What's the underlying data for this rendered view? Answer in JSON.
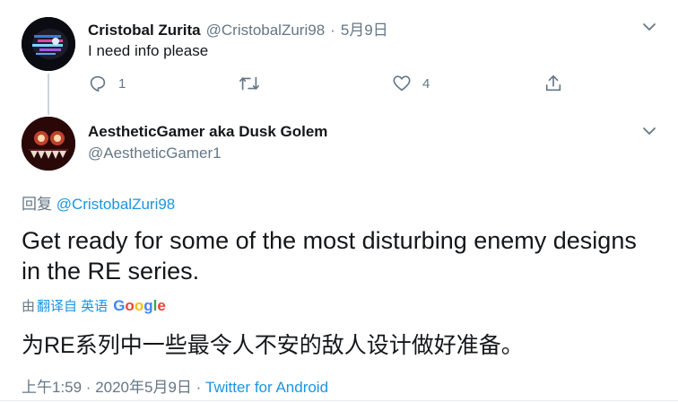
{
  "parent_tweet": {
    "display_name": "Cristobal Zurita",
    "handle": "@CristobalZuri98",
    "date": "5月9日",
    "text": "I need info please",
    "reply_count": "1",
    "like_count": "4"
  },
  "main_tweet": {
    "display_name": "AestheticGamer aka Dusk Golem",
    "handle": "@AestheticGamer1",
    "reply_prefix": "回复",
    "reply_to": "@CristobalZuri98",
    "text": "Get ready for some of the most disturbing enemy designs in the RE series.",
    "translated_by_prefix": "由",
    "translate_link": "翻译自 英语",
    "translator_brand": "Google",
    "translated_text": "为RE系列中一些最令人不安的敌人设计做好准备。",
    "timestamp": "上午1:59 · 2020年5月9日",
    "separator": " · ",
    "source": "Twitter for Android"
  },
  "colors": {
    "link": "#1b95e0",
    "muted": "#657786",
    "text": "#14171a"
  }
}
